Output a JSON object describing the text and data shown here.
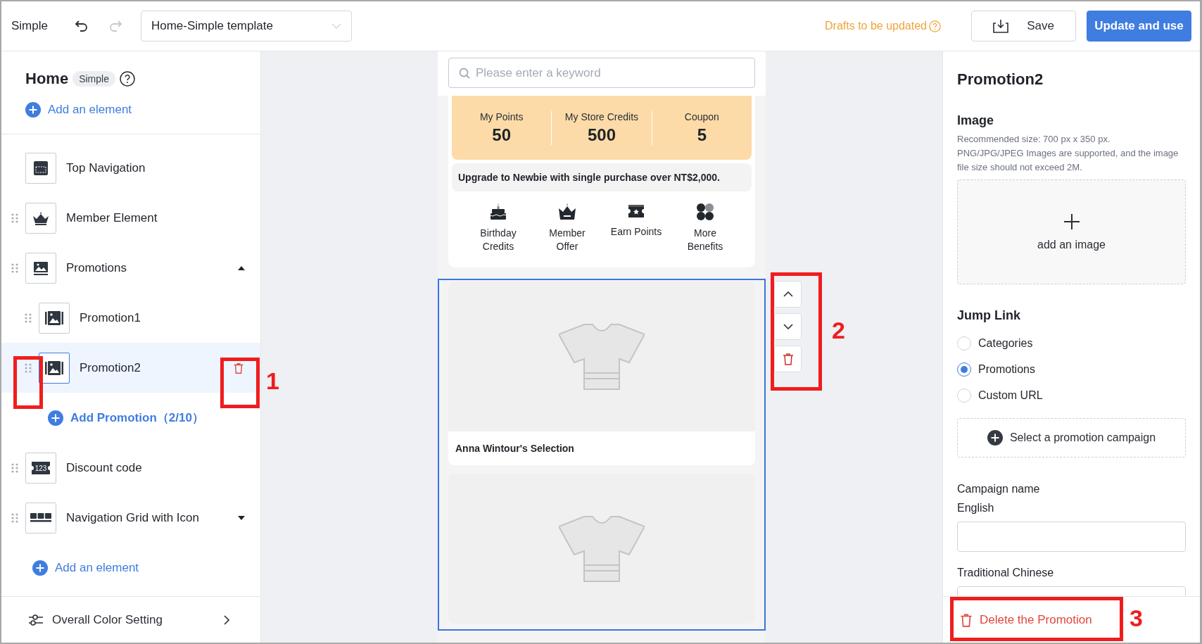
{
  "top_bar": {
    "mode": "Simple",
    "undo": {
      "disabled": false
    },
    "redo": {
      "disabled": true
    },
    "template_select": {
      "value": "Home-Simple template"
    },
    "draft_status": "Drafts to be updated",
    "buttons": [
      {
        "label": "Save",
        "kind": "secondary"
      },
      {
        "label": "Update and use",
        "kind": "primary"
      }
    ]
  },
  "left_panel": {
    "title": "Home",
    "badge": "Simple",
    "add_element_top": "Add an element",
    "elements": [
      {
        "label": "Top Navigation",
        "kind": "top_navigation",
        "draggable": false,
        "selected": false
      },
      {
        "label": "Member Element",
        "kind": "member",
        "draggable": true,
        "selected": false
      },
      {
        "label": "Promotions",
        "kind": "promotions",
        "draggable": true,
        "selected": false,
        "expanded": true,
        "children": [
          {
            "label": "Promotion1",
            "kind": "promotion",
            "draggable": true,
            "selected": false
          },
          {
            "label": "Promotion2",
            "kind": "promotion",
            "draggable": true,
            "selected": true
          }
        ],
        "add_child": "Add Promotion（2/10）"
      },
      {
        "label": "Discount code",
        "kind": "discount",
        "icon_text": "123",
        "draggable": true,
        "selected": false
      },
      {
        "label": "Navigation Grid with Icon",
        "kind": "nav_grid",
        "draggable": true,
        "selected": false,
        "expanded": false
      }
    ],
    "add_element_bottom": "Add an element",
    "footer": "Overall Color Setting"
  },
  "preview": {
    "search_placeholder": "Please enter a keyword",
    "stats": [
      {
        "label": "My Points",
        "value": "50"
      },
      {
        "label": "My Store Credits",
        "value": "500"
      },
      {
        "label": "Coupon",
        "value": "5"
      }
    ],
    "upgrade_notice": "Upgrade to Newbie with single purchase over NT$2,000.",
    "benefits": [
      {
        "label": "Birthday Credits",
        "kind": "cake"
      },
      {
        "label": "Member Offer",
        "kind": "crown"
      },
      {
        "label": "Earn Points",
        "kind": "ticket"
      },
      {
        "label": "More Benefits",
        "kind": "more"
      }
    ],
    "promotion_cards": [
      {
        "kind": "captioned",
        "caption": "Anna Wintour's Selection"
      },
      {
        "kind": "image_only"
      }
    ]
  },
  "right_panel": {
    "title": "Promotion2",
    "image": {
      "heading": "Image",
      "hint": "Recommended size: 700 px x 350 px.\nPNG/JPG/JPEG Images are supported, and the image file size should not exceed 2M.",
      "upload_label": "add an image"
    },
    "jump_link": {
      "heading": "Jump Link",
      "options": [
        {
          "label": "Categories",
          "selected": false
        },
        {
          "label": "Promotions",
          "selected": true
        },
        {
          "label": "Custom URL",
          "selected": false
        }
      ],
      "campaign_button": "Select a promotion campaign"
    },
    "campaign_name": {
      "heading": "Campaign name",
      "fields": [
        {
          "label": "English"
        },
        {
          "label": "Traditional Chinese"
        }
      ]
    },
    "delete_button": "Delete the Promotion"
  },
  "annotations": [
    {
      "label": "1"
    },
    {
      "label": "2"
    },
    {
      "label": "3"
    }
  ]
}
